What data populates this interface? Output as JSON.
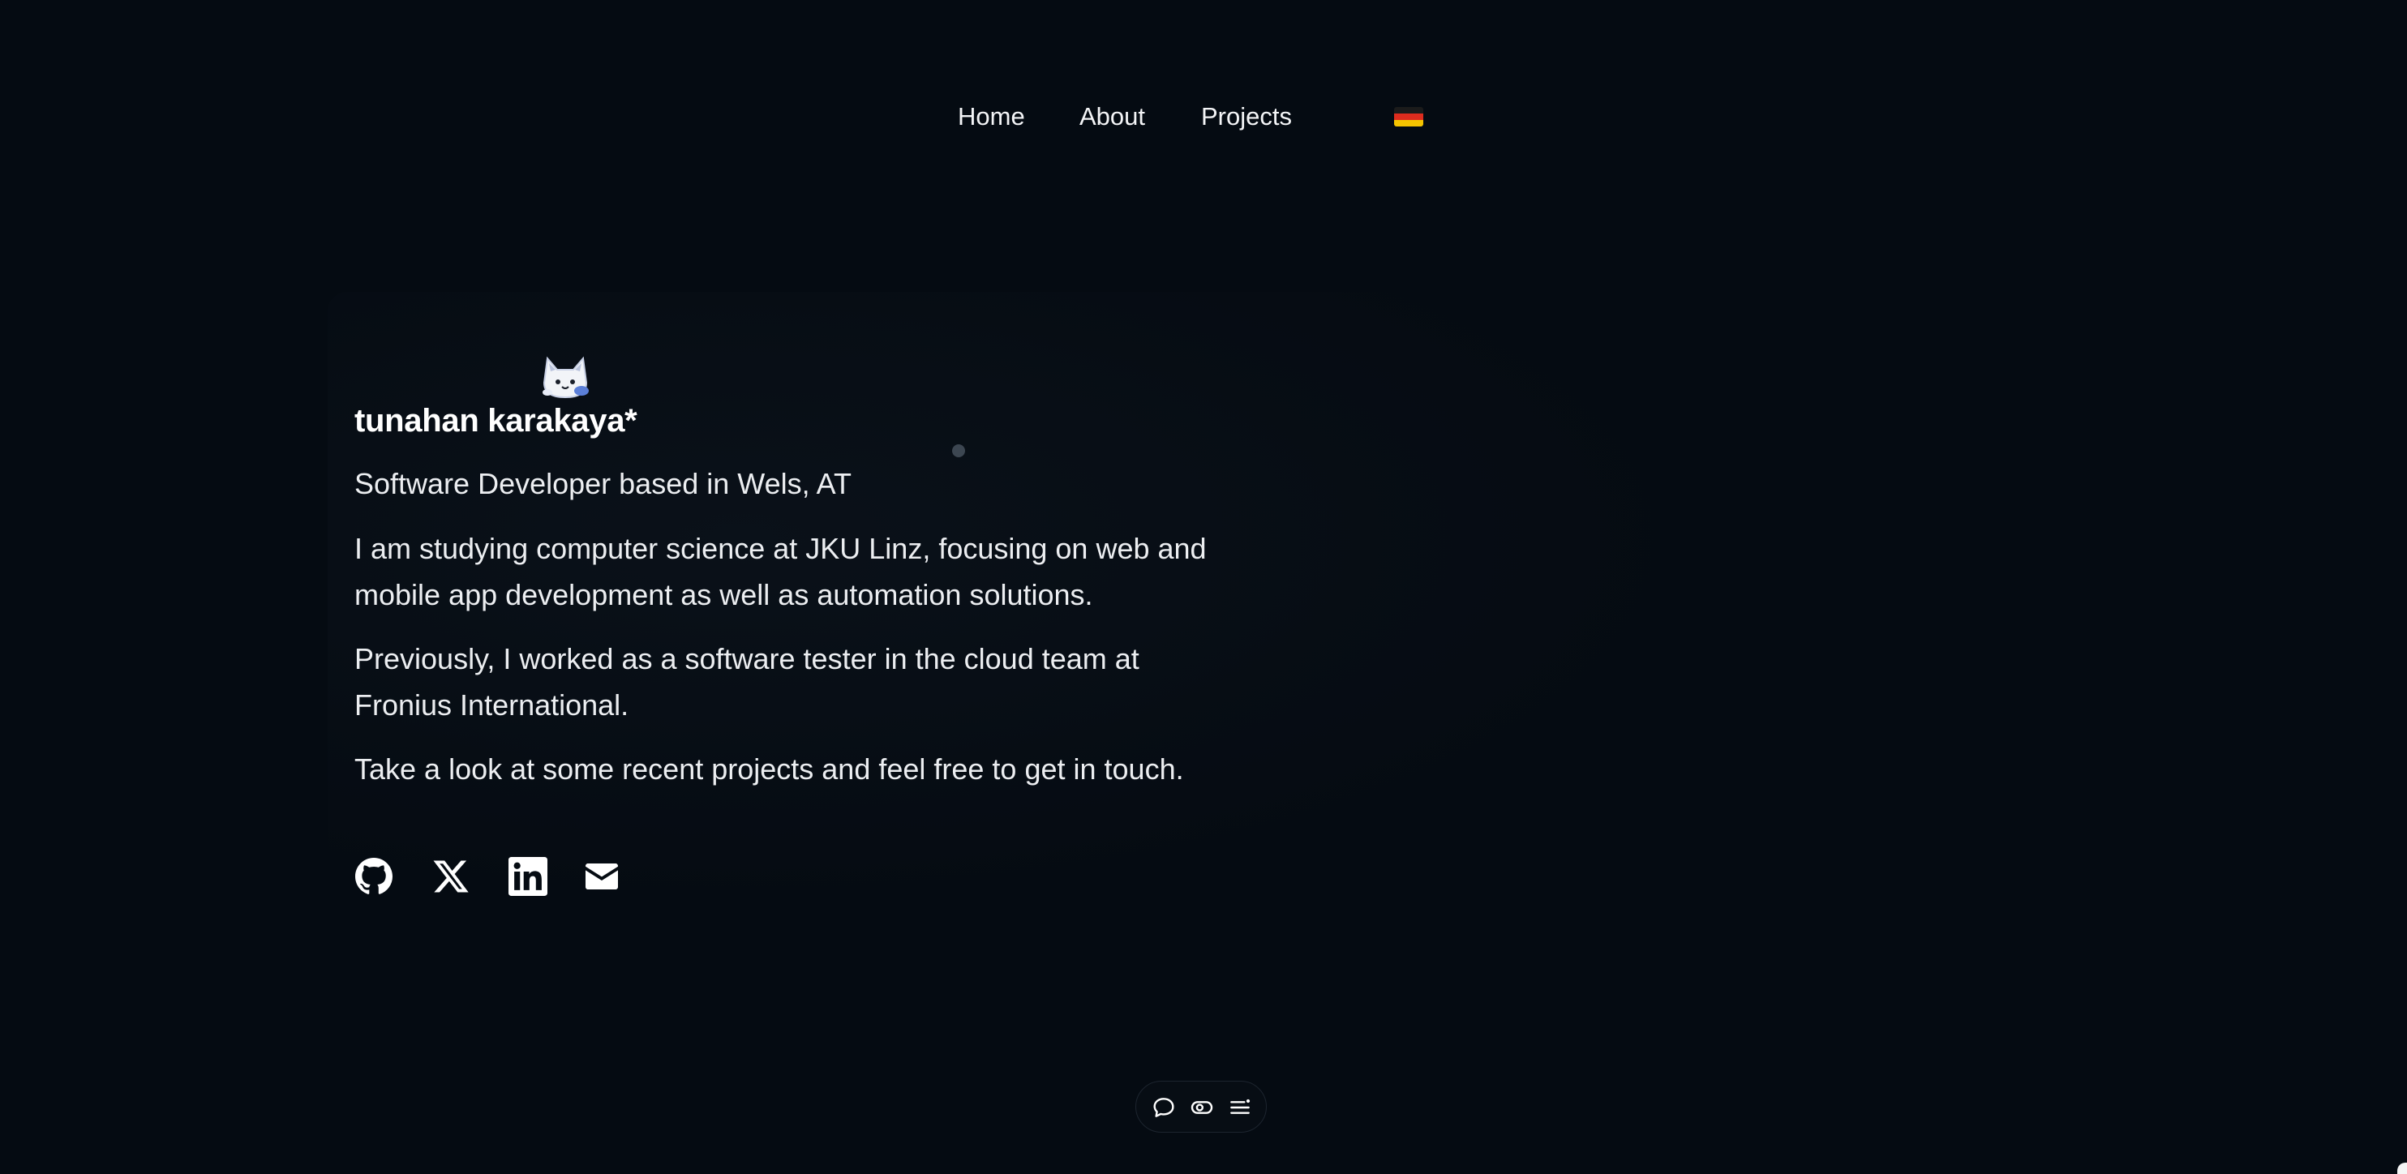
{
  "nav": {
    "home": "Home",
    "about": "About",
    "projects": "Projects",
    "language_flag": "german-flag-icon"
  },
  "hero": {
    "name": "tunahan karakaya*",
    "tagline": "Software Developer based in Wels, AT",
    "paragraph_study": "I am studying computer science at JKU Linz, focusing on web and mobile app development as well as automation solutions.",
    "paragraph_previous": "Previously, I worked as a software tester in the cloud team at Fronius International.",
    "paragraph_cta": "Take a look at some recent projects and feel free to get in touch."
  },
  "socials": [
    {
      "icon": "github-icon"
    },
    {
      "icon": "x-icon"
    },
    {
      "icon": "linkedin-icon"
    },
    {
      "icon": "mail-icon"
    }
  ],
  "dock": [
    {
      "icon": "chat-bubble-icon"
    },
    {
      "icon": "toggle-icon"
    },
    {
      "icon": "menu-lines-icon"
    }
  ],
  "colors": {
    "background": "#050b12",
    "text": "#eceef1",
    "flag_black": "#1b1b1b",
    "flag_red": "#dd2c1e",
    "flag_gold": "#f5c400"
  }
}
